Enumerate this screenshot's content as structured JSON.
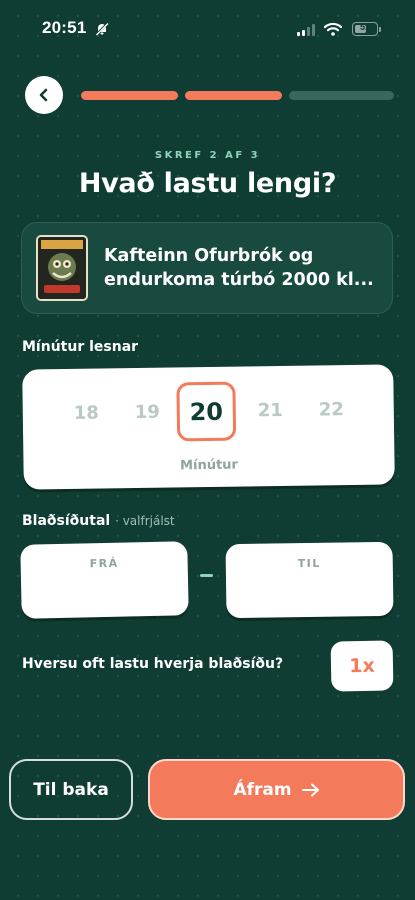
{
  "status_bar": {
    "time": "20:51",
    "battery_level": 0.55,
    "battery_text": "51"
  },
  "progress": {
    "total_steps": 3,
    "completed_steps": 2
  },
  "step_label": "SKREF 2 AF 3",
  "title": "Hvað lastu lengi?",
  "book": {
    "title_line1": "Kafteinn Ofurbrók og",
    "title_line2": "endurkoma túrbó 2000 kl...",
    "cover_icon": "book-cover-image"
  },
  "minutes": {
    "label": "Mínútur lesnar",
    "options": [
      "18",
      "19",
      "20",
      "21",
      "22"
    ],
    "selected": "20",
    "unit": "Mínútur"
  },
  "pages": {
    "label": "Blaðsíðutal",
    "optional": "· valfrjálst",
    "from_label": "FRÁ",
    "to_label": "TIL",
    "from_value": "",
    "to_value": ""
  },
  "repeat": {
    "label": "Hversu oft lastu hverja blaðsíðu?",
    "value": "1x"
  },
  "buttons": {
    "back": "Til baka",
    "next": "Áfram",
    "next_icon": "arrow-right-icon"
  },
  "colors": {
    "background": "#0f3d33",
    "accent": "#f47a5c",
    "mint": "#8fd3bd"
  }
}
